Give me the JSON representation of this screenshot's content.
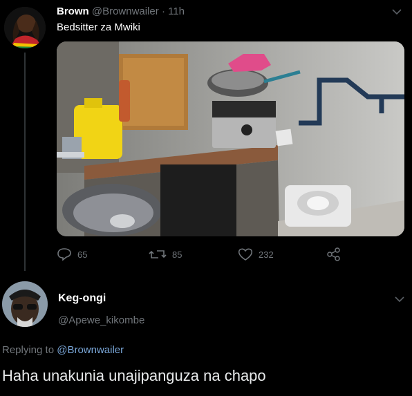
{
  "tweet": {
    "author_name": "Brown",
    "author_handle": "@Brownwailer",
    "separator": "·",
    "time": "11h",
    "text": "Bedsitter za Mwiki",
    "stats": {
      "replies": "65",
      "retweets": "85",
      "likes": "232"
    }
  },
  "reply": {
    "author_name": "Keg-ongi",
    "author_handle": "@Apewe_kikombe",
    "replying_prefix": "Replying to",
    "replying_handle": "@Brownwailer",
    "text": "Haha unakunia unajipanguza na chapo"
  },
  "icons": [
    "chevron-down-icon",
    "reply-icon",
    "retweet-icon",
    "like-icon",
    "share-icon"
  ],
  "colors": {
    "background": "#000000",
    "muted": "#71767b",
    "link": "#7aa7d9"
  }
}
